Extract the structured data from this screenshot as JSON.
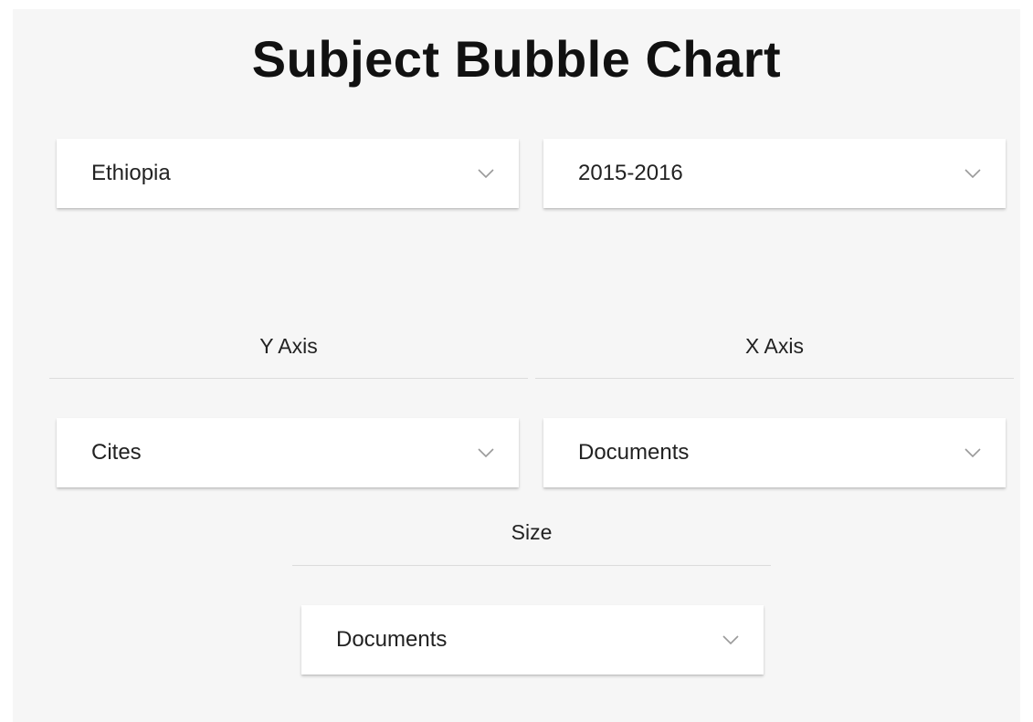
{
  "title": "Subject Bubble Chart",
  "filters": {
    "country": "Ethiopia",
    "period": "2015-2016"
  },
  "axes": {
    "y_label": "Y Axis",
    "y_value": "Cites",
    "x_label": "X Axis",
    "x_value": "Documents",
    "size_label": "Size",
    "size_value": "Documents"
  },
  "icons": {
    "dropdown": "chevron-down-icon"
  }
}
